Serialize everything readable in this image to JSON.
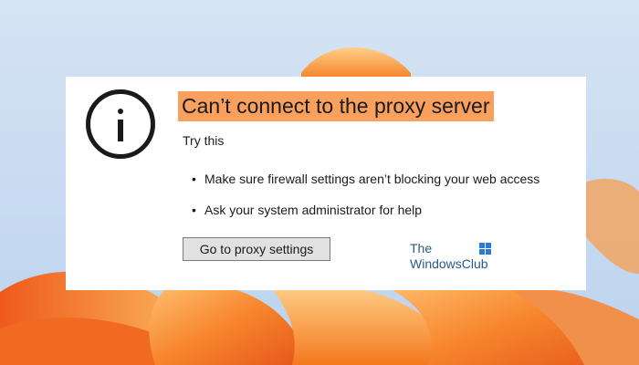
{
  "dialog": {
    "title": "Can’t connect to the proxy server",
    "subtitle": "Try this",
    "bullets": [
      "Make sure firewall settings aren’t blocking your web access",
      "Ask your system administrator for help"
    ],
    "button_label": "Go to proxy settings",
    "icon": "info-icon"
  },
  "watermark": {
    "line1": "The",
    "line2": "WindowsClub"
  },
  "colors": {
    "title_highlight": "#f9a05e",
    "background": "#c9dcf2",
    "wallpaper_orange": "#f57c1f"
  }
}
